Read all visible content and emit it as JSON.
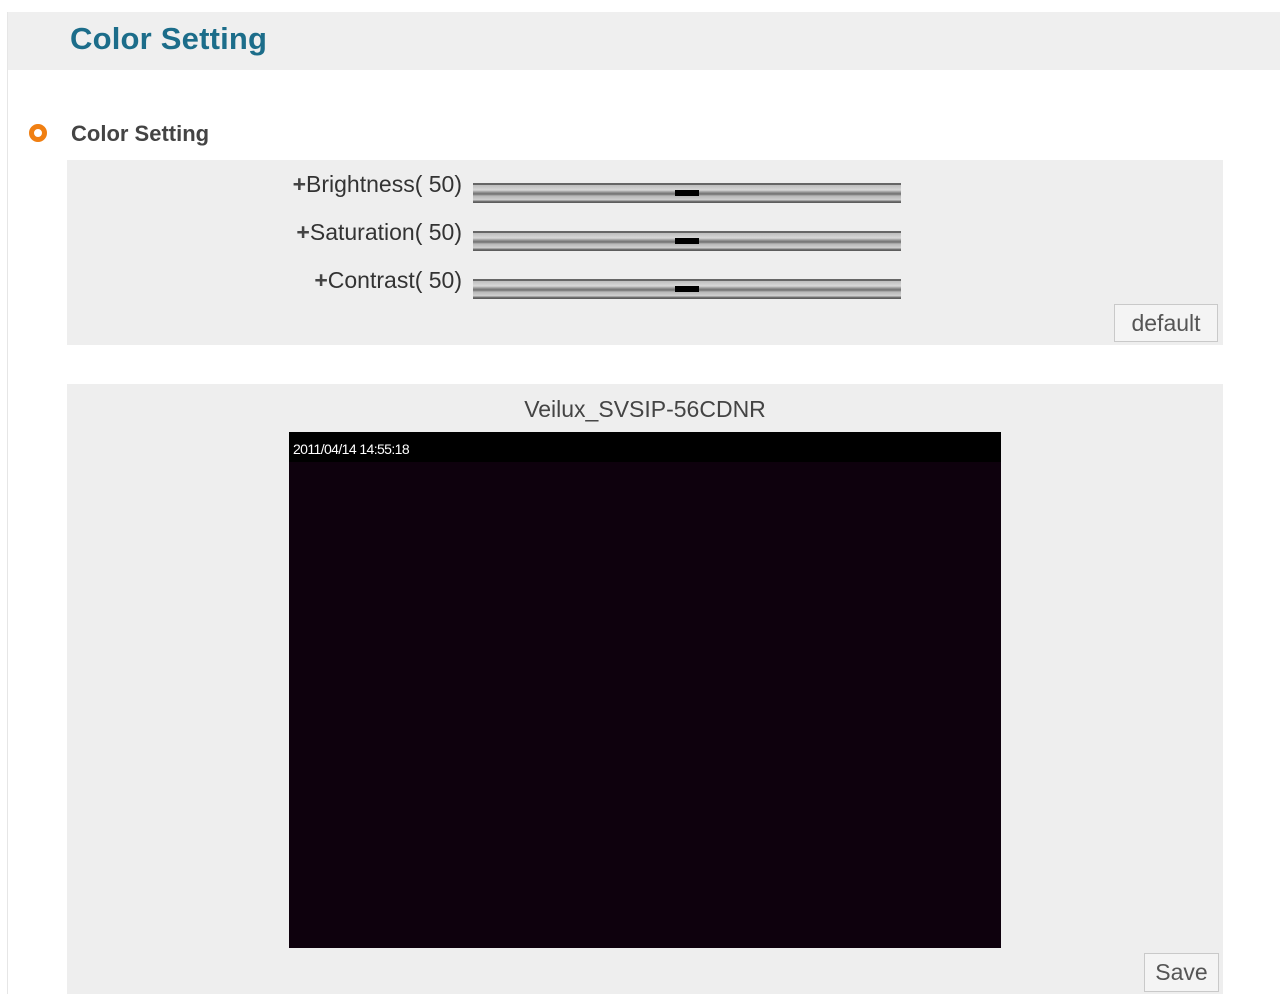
{
  "header": {
    "title": "Color Setting"
  },
  "section": {
    "title": "Color Setting",
    "bullet_color": "#f07f12"
  },
  "sliders": [
    {
      "label": "Brightness( 50)",
      "value": 50,
      "min": 0,
      "max": 100
    },
    {
      "label": "Saturation( 50)",
      "value": 50,
      "min": 0,
      "max": 100
    },
    {
      "label": "Contrast( 50)",
      "value": 50,
      "min": 0,
      "max": 100
    }
  ],
  "buttons": {
    "default_label": "default",
    "save_label": "Save"
  },
  "preview": {
    "camera_name": "Veilux_SVSIP-56CDNR",
    "timestamp": "2011/04/14 14:55:18"
  },
  "colors": {
    "title": "#1c6d8a",
    "panel_bg": "#eeeeee",
    "video_bg": "#0e010d"
  }
}
